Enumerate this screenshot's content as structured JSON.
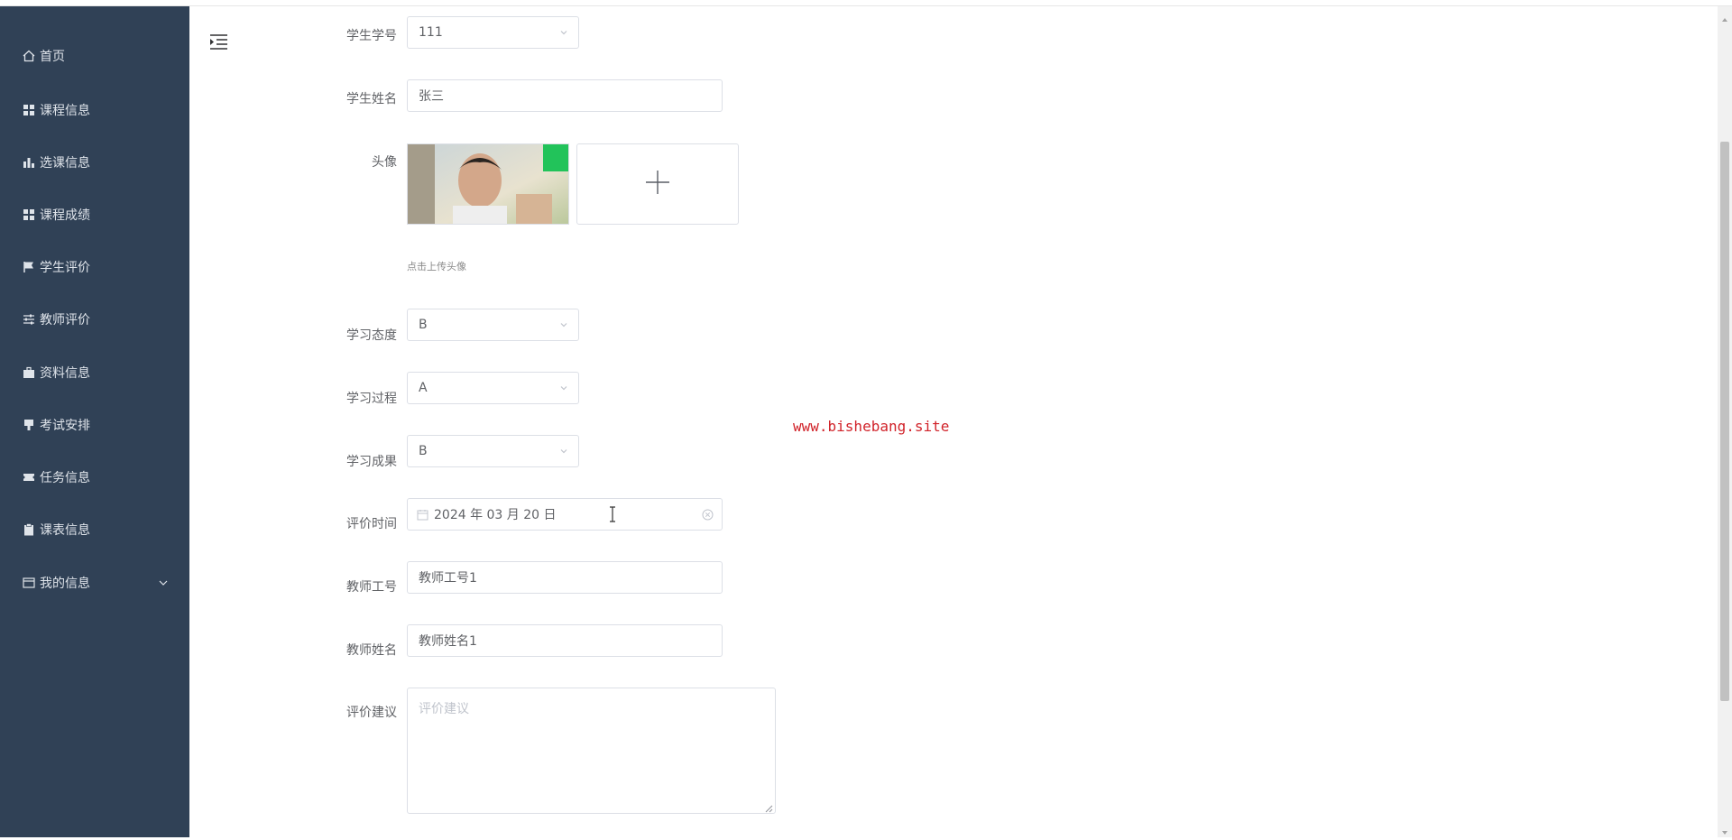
{
  "sidebar": {
    "items": [
      {
        "label": "首页",
        "icon": "home-icon"
      },
      {
        "label": "课程信息",
        "icon": "grid-icon"
      },
      {
        "label": "选课信息",
        "icon": "bar-chart-icon"
      },
      {
        "label": "课程成绩",
        "icon": "grid-icon"
      },
      {
        "label": "学生评价",
        "icon": "flag-icon"
      },
      {
        "label": "教师评价",
        "icon": "sliders-icon"
      },
      {
        "label": "资料信息",
        "icon": "briefcase-icon"
      },
      {
        "label": "考试安排",
        "icon": "stamp-icon"
      },
      {
        "label": "任务信息",
        "icon": "ticket-icon"
      },
      {
        "label": "课表信息",
        "icon": "clipboard-icon"
      },
      {
        "label": "我的信息",
        "icon": "id-card-icon"
      }
    ]
  },
  "form": {
    "student_no": {
      "label": "学生学号",
      "value": "111"
    },
    "student_name": {
      "label": "学生姓名",
      "value": "张三"
    },
    "avatar": {
      "label": "头像",
      "hint": "点击上传头像"
    },
    "attitude": {
      "label": "学习态度",
      "value": "B"
    },
    "process": {
      "label": "学习过程",
      "value": "A"
    },
    "result": {
      "label": "学习成果",
      "value": "B"
    },
    "eval_time": {
      "label": "评价时间",
      "value": "2024 年 03 月 20 日"
    },
    "teacher_no": {
      "label": "教师工号",
      "value": "教师工号1"
    },
    "teacher_name": {
      "label": "教师姓名",
      "value": "教师姓名1"
    },
    "suggestion": {
      "label": "评价建议",
      "placeholder": "评价建议"
    }
  },
  "watermark": "www.bishebang.site",
  "colors": {
    "sidebar_bg": "#304156",
    "watermark": "#d1232a",
    "border": "#dcdfe6"
  }
}
